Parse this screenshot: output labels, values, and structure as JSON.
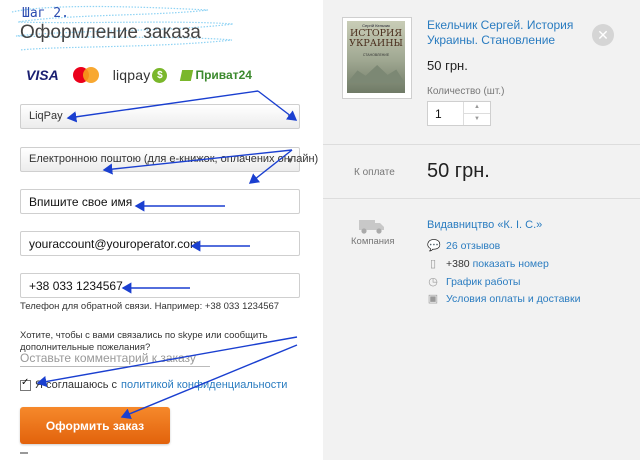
{
  "annotation": {
    "step": "Шаг 2."
  },
  "form": {
    "title": "Оформление заказа",
    "payment_logos": {
      "visa": "VISA",
      "mastercard": "MasterCard",
      "liqpay": "liqpay",
      "privat": "Приват24"
    },
    "payment_select": "LiqPay",
    "delivery_select": "Електронною поштою (для е-книжок, оплачених онлайн)",
    "name_input": "Впишите свое имя",
    "email_input": "youraccount@youroperator.com",
    "phone_input": "+38 033 1234567",
    "phone_hint": "Телефон для обратной связи. Например: +38 033 1234567",
    "skype_question": "Хотите, чтобы с вами связались по skype или сообщить дополнительные пожелания?",
    "comment_placeholder": "Оставьте комментарий к заказу",
    "agree_text": "Я соглашаюсь с",
    "privacy_link": "политикой конфиденциальности",
    "agree_checked": true,
    "submit_label": "Оформить заказ"
  },
  "product": {
    "cover": {
      "author": "Сергій Кельчик",
      "title": "ИСТОРИЯ УКРАИНЫ",
      "subtitle": "СТАНОВЛЕНИЕ"
    },
    "title": "Екельчик Сергей. История Украины. Становление",
    "price": "50 грн.",
    "qty_label": "Количество (шт.)",
    "qty_value": "1",
    "close_icon": "close-icon"
  },
  "summary": {
    "pay_label": "К оплате",
    "total": "50 грн."
  },
  "company": {
    "label": "Компания",
    "name": "Видавництво «К. І. С.»",
    "reviews": "26 отзывов",
    "phone_prefix": "+380",
    "phone_action": "показать номер",
    "schedule": "График работы",
    "terms": "Условия оплаты и доставки"
  },
  "colors": {
    "accent": "#f07a1e",
    "link": "#2a7cc0",
    "annotation": "#1a3fd0"
  }
}
